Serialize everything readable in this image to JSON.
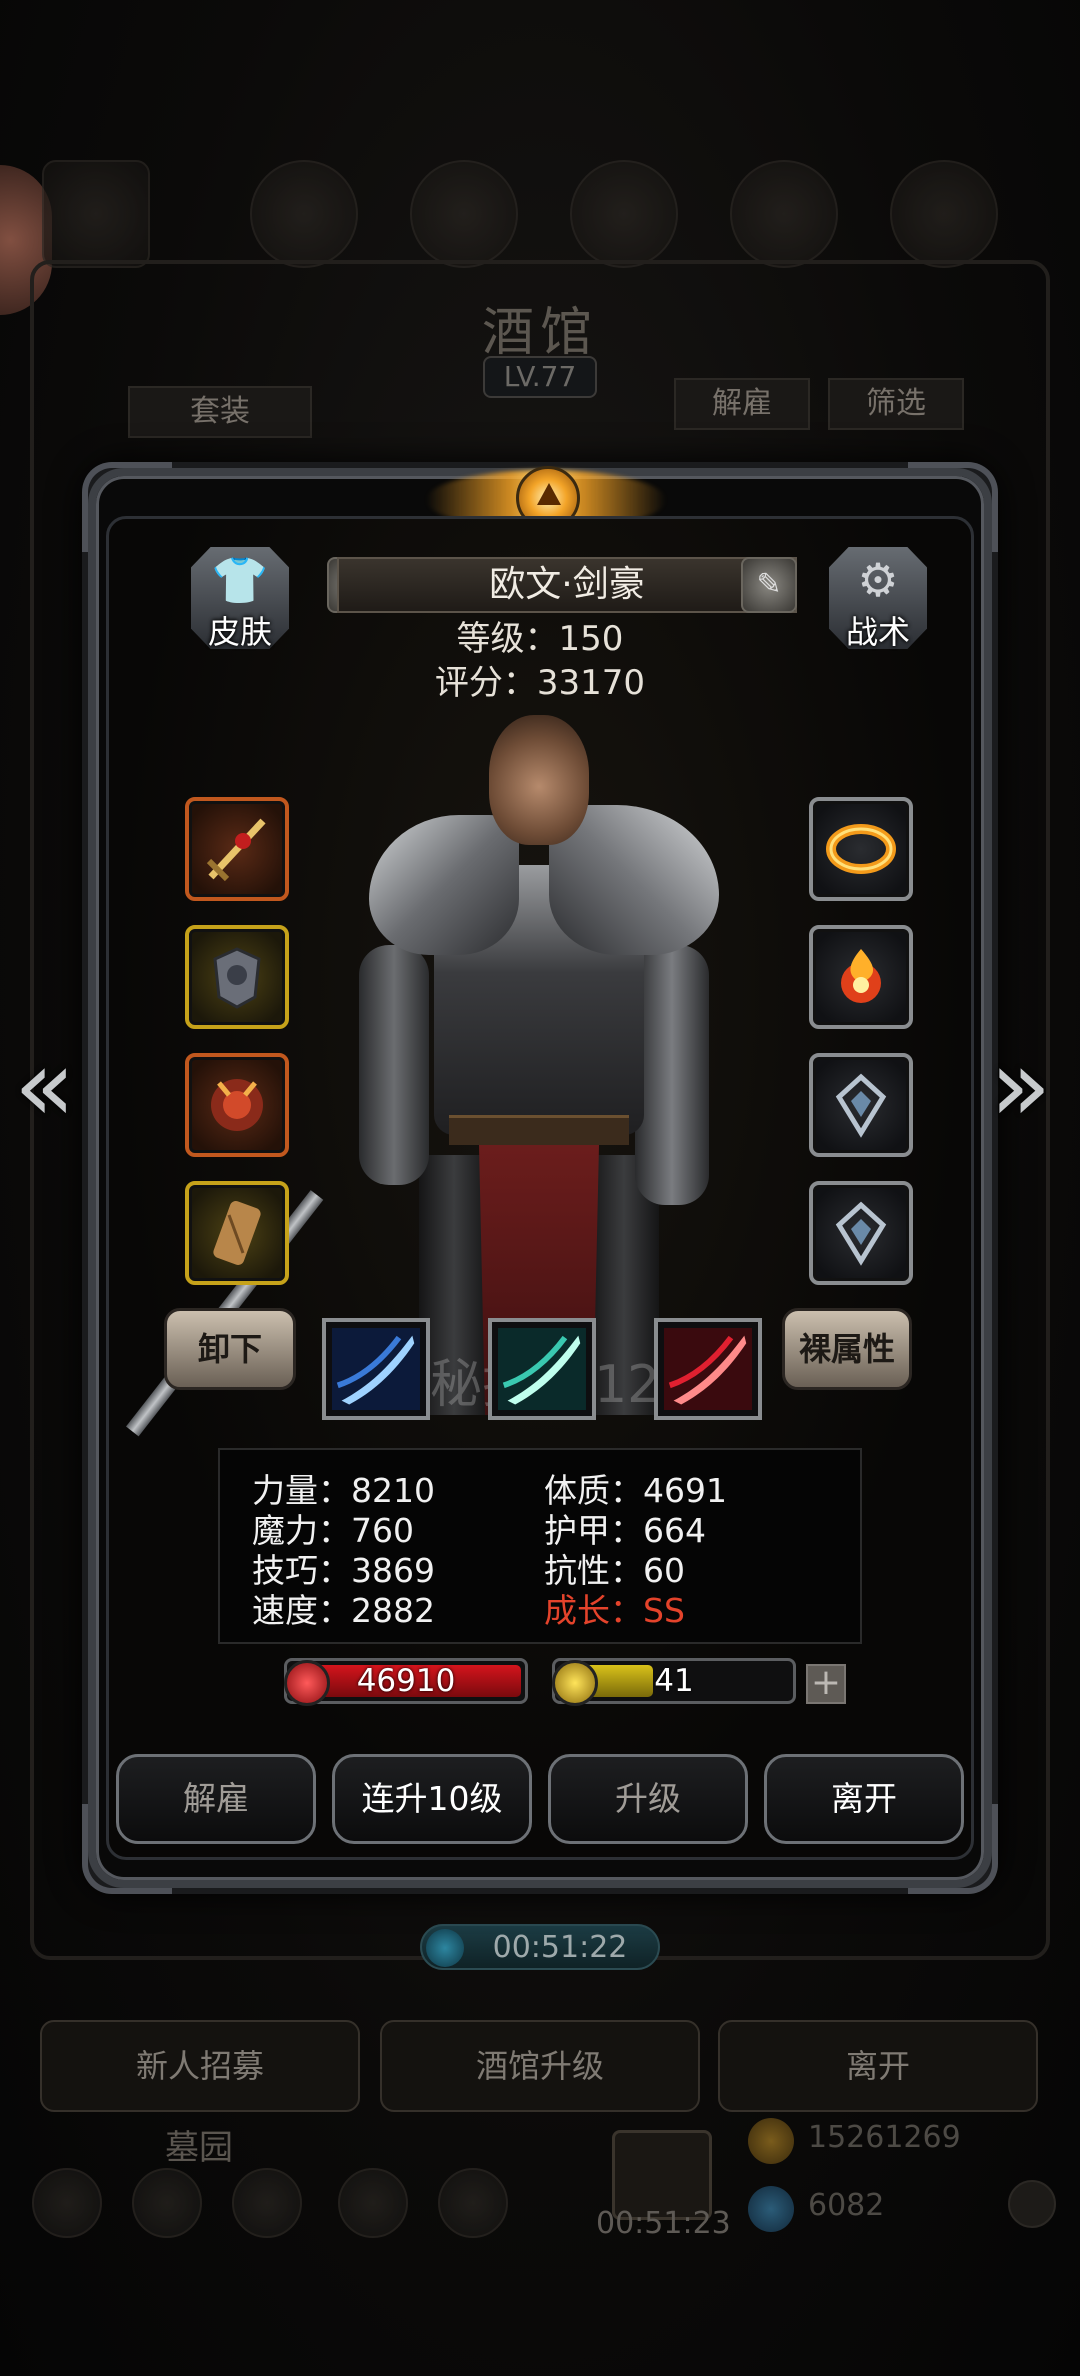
{
  "background": {
    "tavern_title": "酒馆",
    "tavern_level": "LV.77",
    "set_button": "套装",
    "dismiss_button": "解雇",
    "filter_button": "筛选",
    "timer": "00:51:22",
    "bottom_buttons": [
      "新人招募",
      "酒馆升级",
      "离开"
    ],
    "cemetery_label": "墓园",
    "gift_timer": "00:51:23",
    "gold": "15261269",
    "gems": "6082"
  },
  "hero": {
    "name": "欧文·剑豪",
    "level_line": "等级：150",
    "score_line": "评分：33170",
    "skin_label": "皮肤",
    "tactics_label": "战术",
    "unequip_label": "卸下",
    "base_attr_label": "裸属性",
    "secret_label": "秘技 +12"
  },
  "icons": {
    "skin": "shirt-swap-icon",
    "tactics": "gear-icon",
    "rename": "pencil-icon",
    "settings": "cog-badge-icon"
  },
  "equipment_left": [
    {
      "name": "weapon-slot",
      "rarity": "orange"
    },
    {
      "name": "armor-slot",
      "rarity": "yellow"
    },
    {
      "name": "accessory-slot",
      "rarity": "orange"
    },
    {
      "name": "scroll-slot",
      "rarity": "yellow"
    }
  ],
  "equipment_right": [
    {
      "name": "fire-ring-slot",
      "rarity": "silver"
    },
    {
      "name": "fire-orb-slot",
      "rarity": "silver"
    },
    {
      "name": "rune-slot-1",
      "rarity": "silver"
    },
    {
      "name": "rune-slot-2",
      "rarity": "silver"
    }
  ],
  "stats": {
    "strength": "力量：8210",
    "constitution": "体质：4691",
    "magic": "魔力：760",
    "armor": "护甲：664",
    "skill": "技巧：3869",
    "resistance": "抗性：60",
    "speed": "速度：2882",
    "growth": "成长：SS"
  },
  "hp": {
    "value": "46910",
    "fill": 1.0
  },
  "energy": {
    "value": "41",
    "fill": 0.41
  },
  "actions": {
    "dismiss": "解雇",
    "level_up_10": "连升10级",
    "level_up": "升级",
    "leave": "离开"
  },
  "colors": {
    "hp": "#d4141c",
    "energy": "#d9c21a",
    "growth_accent": "#e4432b"
  }
}
